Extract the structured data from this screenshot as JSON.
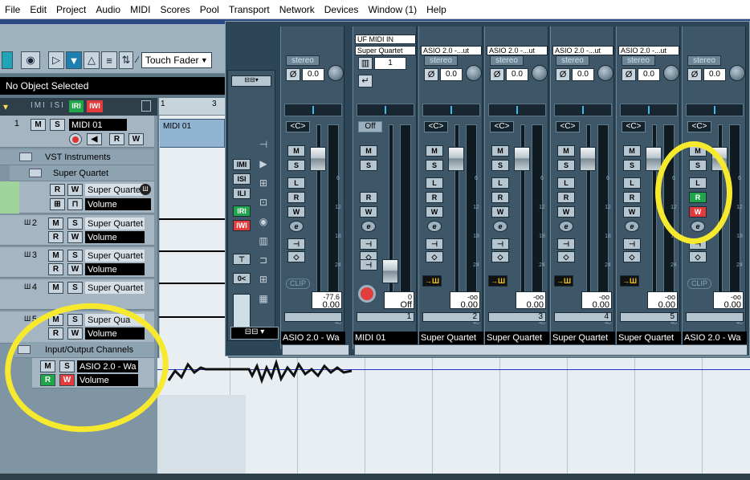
{
  "menu": [
    "File",
    "Edit",
    "Project",
    "Audio",
    "MIDI",
    "Scores",
    "Pool",
    "Transport",
    "Network",
    "Devices",
    "Window (1)",
    "Help"
  ],
  "toolbar": {
    "automation_mode": "Touch Fader"
  },
  "info_line": "No Object Selected",
  "ruler": {
    "marks": [
      "1",
      "3"
    ]
  },
  "arrange": {
    "part_label": "MIDI 01"
  },
  "tracks": [
    {
      "num": "1",
      "name": "MIDI 01",
      "type": "midi"
    },
    {
      "folder": "VST Instruments"
    },
    {
      "folder": "Super Quartet"
    },
    {
      "name": "Super Quartet",
      "sub": "Volume"
    },
    {
      "num": "2",
      "name": "Super Quartet",
      "sub": "Volume"
    },
    {
      "num": "3",
      "name": "Super Quartet",
      "sub": "Volume"
    },
    {
      "num": "4",
      "name": "Super Quartet"
    },
    {
      "num": "5",
      "name": "Super Qua",
      "sub": "Volume"
    },
    {
      "folder": "Input/Output Channels"
    },
    {
      "name": "ASIO 2.0 - Wa",
      "sub": "Volume"
    }
  ],
  "mixer": {
    "channels": [
      {
        "io": "",
        "top": "",
        "stereo": "stereo",
        "pan": "0.0",
        "cbtn": "<C>",
        "val_top": "-77.6",
        "val": "0.00",
        "num": "",
        "name": "ASIO 2.0 - Wa",
        "type": "left"
      },
      {
        "io": "Super Quartet",
        "top": "UF MIDI IN",
        "stereo": "",
        "pan": "",
        "cbtn": "Off",
        "val_top": "0",
        "val": "Off",
        "num": "1",
        "name": "MIDI 01",
        "type": "midi",
        "chan": "1"
      },
      {
        "io": "ASIO 2.0 -...ut",
        "top": "",
        "stereo": "stereo",
        "pan": "0.0",
        "cbtn": "<C>",
        "val_top": "-oo",
        "val": "0.00",
        "num": "2",
        "name": "Super Quartet",
        "type": "inst"
      },
      {
        "io": "ASIO 2.0 -...ut",
        "top": "",
        "stereo": "stereo",
        "pan": "0.0",
        "cbtn": "<C>",
        "val_top": "-oo",
        "val": "0.00",
        "num": "3",
        "name": "Super Quartet",
        "type": "inst"
      },
      {
        "io": "ASIO 2.0 -...ut",
        "top": "",
        "stereo": "stereo",
        "pan": "0.0",
        "cbtn": "<C>",
        "val_top": "-oo",
        "val": "0.00",
        "num": "4",
        "name": "Super Quartet",
        "type": "inst"
      },
      {
        "io": "ASIO 2.0 -...ut",
        "top": "",
        "stereo": "stereo",
        "pan": "0.0",
        "cbtn": "<C>",
        "val_top": "-oo",
        "val": "0.00",
        "num": "5",
        "name": "Super Quartet",
        "type": "inst"
      },
      {
        "io": "",
        "top": "",
        "stereo": "stereo",
        "pan": "0.0",
        "cbtn": "<C>",
        "val_top": "-oo",
        "val": "0.00",
        "num": "",
        "name": "ASIO 2.0 - Wa",
        "type": "out"
      }
    ],
    "scale": [
      "6",
      "12",
      "18",
      "24",
      "30",
      "40"
    ],
    "clip_label": "CLIP"
  },
  "buttons": {
    "m": "M",
    "s": "S",
    "r": "R",
    "w": "W",
    "l": "L",
    "e": "e"
  }
}
